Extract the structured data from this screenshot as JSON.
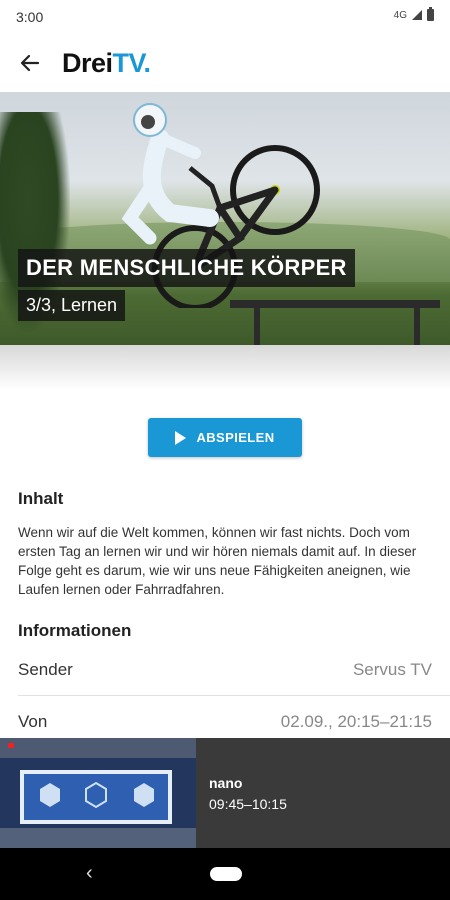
{
  "status_bar": {
    "time": "3:00",
    "network": "4G"
  },
  "app_bar": {
    "logo_part1": "Drei",
    "logo_part2": "TV."
  },
  "hero": {
    "title": "DER MENSCHLICHE KÖRPER",
    "subtitle": "3/3, Lernen"
  },
  "play_button": {
    "label": "ABSPIELEN"
  },
  "content": {
    "heading": "Inhalt",
    "description": "Wenn wir auf die Welt kommen, können wir fast nichts. Doch vom ersten Tag an lernen wir und wir hören niemals damit auf. In dieser Folge geht es darum, wie wir uns neue Fähigkeiten aneignen, wie Laufen lernen oder Fahrradfahren."
  },
  "information": {
    "heading": "Informationen",
    "rows": [
      {
        "key": "Sender",
        "value": "Servus TV"
      },
      {
        "key": "Von",
        "value": "02.09., 20:15–21:15"
      }
    ]
  },
  "mini_player": {
    "title": "nano",
    "time": "09:45–10:15"
  },
  "colors": {
    "accent": "#1a98d5",
    "mini_player_bg": "#3a3a3a"
  },
  "icons": [
    "back-arrow-icon",
    "play-icon",
    "signal-icon",
    "battery-icon",
    "nav-back-icon",
    "nav-home-icon"
  ]
}
